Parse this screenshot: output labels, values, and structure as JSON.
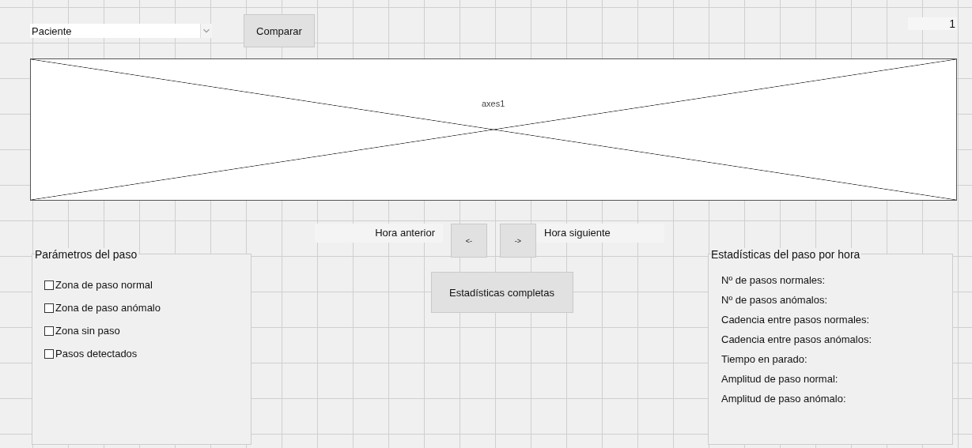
{
  "patient_dropdown": {
    "value": "Paciente"
  },
  "compare_button": "Comparar",
  "counter": "1",
  "axes": {
    "label": "axes1"
  },
  "navigation": {
    "previous_label": "Hora anterior",
    "previous_button": "<-",
    "next_button": "->",
    "next_label": "Hora siguiente"
  },
  "full_stats_button": "Estadísticas completas",
  "step_parameters": {
    "title": "Parámetros del paso",
    "options": [
      {
        "label": "Zona de paso normal",
        "checked": false
      },
      {
        "label": "Zona de paso anómalo",
        "checked": false
      },
      {
        "label": "Zona sin paso",
        "checked": false
      },
      {
        "label": "Pasos detectados",
        "checked": false
      }
    ]
  },
  "hourly_stats": {
    "title": "Estadísticas del paso por hora",
    "items": [
      "Nº de pasos normales:",
      "Nº de pasos anómalos:",
      "Cadencia entre pasos normales:",
      "Cadencia entre pasos anómalos:",
      "Tiempo en parado:",
      "Amplitud de paso normal:",
      "Amplitud de paso anómalo:"
    ]
  }
}
